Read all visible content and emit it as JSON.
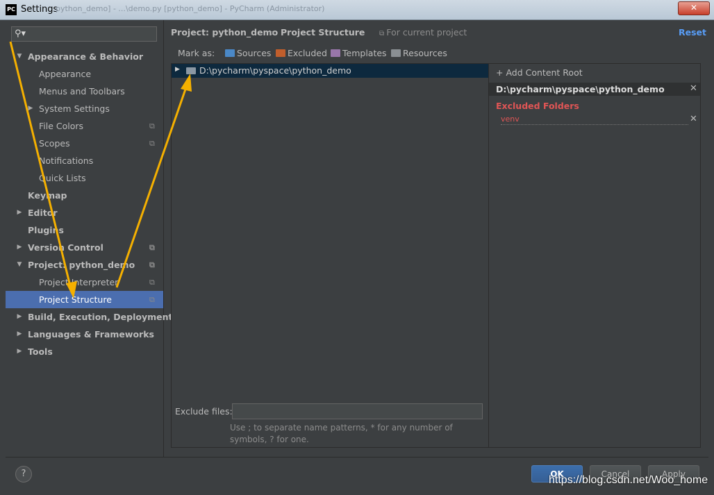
{
  "window": {
    "title": "Settings",
    "ghost_title": "python_demo] - ...\\demo.py [python_demo] - PyCharm (Administrator)",
    "app_icon_text": "PC",
    "close_symbol": "✕"
  },
  "sidebar": {
    "search_placeholder": "",
    "items": [
      {
        "label": "Appearance & Behavior",
        "level": 0,
        "bold": true,
        "arrow": "expanded"
      },
      {
        "label": "Appearance",
        "level": 1,
        "bold": false,
        "arrow": "none"
      },
      {
        "label": "Menus and Toolbars",
        "level": 1,
        "bold": false,
        "arrow": "none"
      },
      {
        "label": "System Settings",
        "level": 1,
        "bold": false,
        "arrow": "collapsed"
      },
      {
        "label": "File Colors",
        "level": 1,
        "bold": false,
        "arrow": "none",
        "copy": true
      },
      {
        "label": "Scopes",
        "level": 1,
        "bold": false,
        "arrow": "none",
        "copy": true
      },
      {
        "label": "Notifications",
        "level": 1,
        "bold": false,
        "arrow": "none"
      },
      {
        "label": "Quick Lists",
        "level": 1,
        "bold": false,
        "arrow": "none"
      },
      {
        "label": "Keymap",
        "level": 0,
        "bold": true,
        "arrow": "none"
      },
      {
        "label": "Editor",
        "level": 0,
        "bold": true,
        "arrow": "collapsed"
      },
      {
        "label": "Plugins",
        "level": 0,
        "bold": true,
        "arrow": "none"
      },
      {
        "label": "Version Control",
        "level": 0,
        "bold": true,
        "arrow": "collapsed",
        "copy": true
      },
      {
        "label": "Project: python_demo",
        "level": 0,
        "bold": true,
        "arrow": "expanded",
        "copy": true
      },
      {
        "label": "Project Interpreter",
        "level": 1,
        "bold": false,
        "arrow": "none",
        "copy": true
      },
      {
        "label": "Project Structure",
        "level": 1,
        "bold": false,
        "arrow": "none",
        "copy": true,
        "selected": true
      },
      {
        "label": "Build, Execution, Deployment",
        "level": 0,
        "bold": true,
        "arrow": "collapsed"
      },
      {
        "label": "Languages & Frameworks",
        "level": 0,
        "bold": true,
        "arrow": "collapsed"
      },
      {
        "label": "Tools",
        "level": 0,
        "bold": true,
        "arrow": "collapsed"
      }
    ]
  },
  "header": {
    "breadcrumb_project": "Project: python_demo",
    "breadcrumb_separator": "›",
    "breadcrumb_page": "Project Structure",
    "for_current_project": "For current project",
    "reset": "Reset"
  },
  "mark_as": {
    "label": "Mark as:",
    "options": [
      {
        "label": "Sources",
        "color": "#4a88c7"
      },
      {
        "label": "Excluded",
        "color": "#c15e2c"
      },
      {
        "label": "Templates",
        "color": "#9876aa"
      },
      {
        "label": "Resources",
        "color": "#8a8f93"
      }
    ]
  },
  "project_tree": {
    "root": "D:\\pycharm\\pyspace\\python_demo"
  },
  "content_root": {
    "add_label": "+ Add Content Root",
    "path": "D:\\pycharm\\pyspace\\python_demo",
    "excluded_title": "Excluded Folders",
    "excluded": [
      "venv"
    ]
  },
  "exclude_files": {
    "label": "Exclude files:",
    "value": "",
    "hint": "Use ; to separate name patterns, * for any number of symbols, ? for one."
  },
  "footer": {
    "help": "?",
    "ok": "OK",
    "cancel": "Cancel",
    "apply": "Apply",
    "watermark": "https://blog.csdn.net/Woo_home"
  },
  "colors": {
    "selection": "#4b6eaf",
    "accent_link": "#589df6",
    "excluded_red": "#e05555",
    "arrow_annotation": "#f5b000"
  }
}
